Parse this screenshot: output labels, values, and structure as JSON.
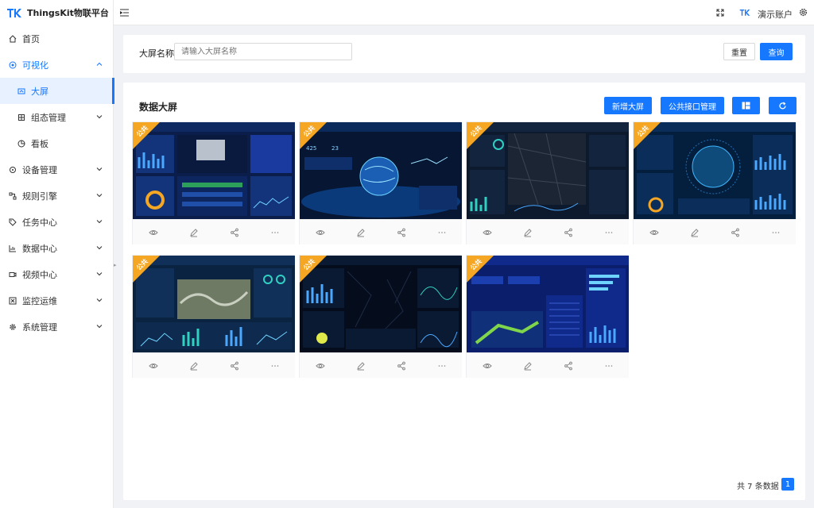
{
  "app": {
    "title": "ThingsKit物联平台",
    "brand_color": "#1677ff",
    "logo_color": "#1677ff"
  },
  "sidebar": {
    "items": [
      {
        "label": "首页",
        "icon": "home-icon"
      },
      {
        "label": "可视化",
        "icon": "eye-icon",
        "expanded": true
      },
      {
        "label": "大屏",
        "icon": "screen-icon",
        "selected": true
      },
      {
        "label": "组态管理",
        "icon": "grid-icon"
      },
      {
        "label": "看板",
        "icon": "pie-icon"
      },
      {
        "label": "设备管理",
        "icon": "device-icon"
      },
      {
        "label": "规则引擎",
        "icon": "rule-icon"
      },
      {
        "label": "任务中心",
        "icon": "tag-icon"
      },
      {
        "label": "数据中心",
        "icon": "chart-icon"
      },
      {
        "label": "视频中心",
        "icon": "video-icon"
      },
      {
        "label": "监控运维",
        "icon": "monitor-icon"
      },
      {
        "label": "系统管理",
        "icon": "gear-icon"
      }
    ]
  },
  "topbar": {
    "user_name": "演示账户"
  },
  "search": {
    "label": "大屏名称",
    "placeholder": "请输入大屏名称",
    "reset_label": "重置",
    "query_label": "查询"
  },
  "list": {
    "title": "数据大屏",
    "add_label": "新增大屏",
    "api_label": "公共接口管理",
    "cards": [
      {
        "badge": "公共"
      },
      {
        "badge": "公共"
      },
      {
        "badge": "公共"
      },
      {
        "badge": "公共"
      },
      {
        "badge": "公共"
      },
      {
        "badge": "公共"
      },
      {
        "badge": "公共"
      }
    ],
    "total_text": "共 7 条数据",
    "current_page": "1"
  }
}
